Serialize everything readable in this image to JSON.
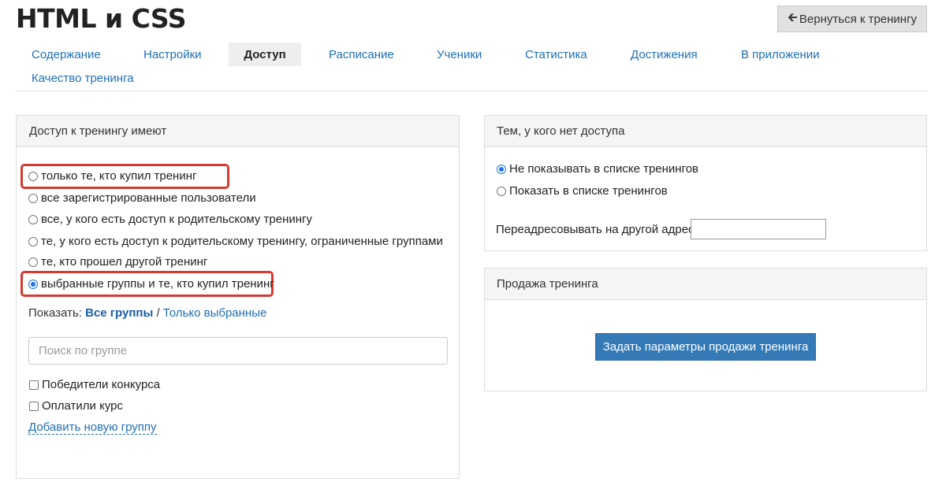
{
  "header": {
    "title": "HTML и CSS",
    "back_label": "Вернуться к тренингу",
    "back_icon": "arrow-left-icon"
  },
  "tabs": [
    {
      "label": "Содержание",
      "active": false
    },
    {
      "label": "Настройки",
      "active": false
    },
    {
      "label": "Доступ",
      "active": true
    },
    {
      "label": "Расписание",
      "active": false
    },
    {
      "label": "Ученики",
      "active": false
    },
    {
      "label": "Статистика",
      "active": false
    },
    {
      "label": "Достижения",
      "active": false
    },
    {
      "label": "В приложении",
      "active": false
    },
    {
      "label": "Качество тренинга",
      "active": false
    }
  ],
  "access_panel": {
    "title": "Доступ к тренингу имеют",
    "options": [
      {
        "label": "только те, кто купил тренинг",
        "checked": false
      },
      {
        "label": "все зарегистрированные пользователи",
        "checked": false
      },
      {
        "label": "все, у кого есть доступ к родительскому тренингу",
        "checked": false
      },
      {
        "label": "те, у кого есть доступ к родительскому тренингу, ограниченные группами",
        "checked": false
      },
      {
        "label": "те, кто прошел другой тренинг",
        "checked": false
      },
      {
        "label": "выбранные группы и те, кто купил тренинг",
        "checked": true
      }
    ],
    "show_label": "Показать:",
    "show_all": "Все группы",
    "show_separator": "/",
    "show_selected": "Только выбранные",
    "search_placeholder": "Поиск по группе",
    "search_value": "",
    "groups": [
      {
        "label": "Победители конкурса",
        "checked": false
      },
      {
        "label": "Оплатили курс",
        "checked": false
      }
    ],
    "add_group_label": "Добавить новую группу"
  },
  "no_access_panel": {
    "title": "Тем, у кого нет доступа",
    "options": [
      {
        "label": "Не показывать в списке тренингов",
        "checked": true
      },
      {
        "label": "Показать в списке тренингов",
        "checked": false
      }
    ],
    "redirect_label": "Переадресовывать на другой адрес",
    "redirect_value": ""
  },
  "sale_panel": {
    "title": "Продажа тренинга",
    "button_label": "Задать параметры продажи тренинга"
  },
  "colors": {
    "link": "#1f6fb5",
    "primary_button": "#337ab7",
    "highlight": "#d63a2f"
  }
}
